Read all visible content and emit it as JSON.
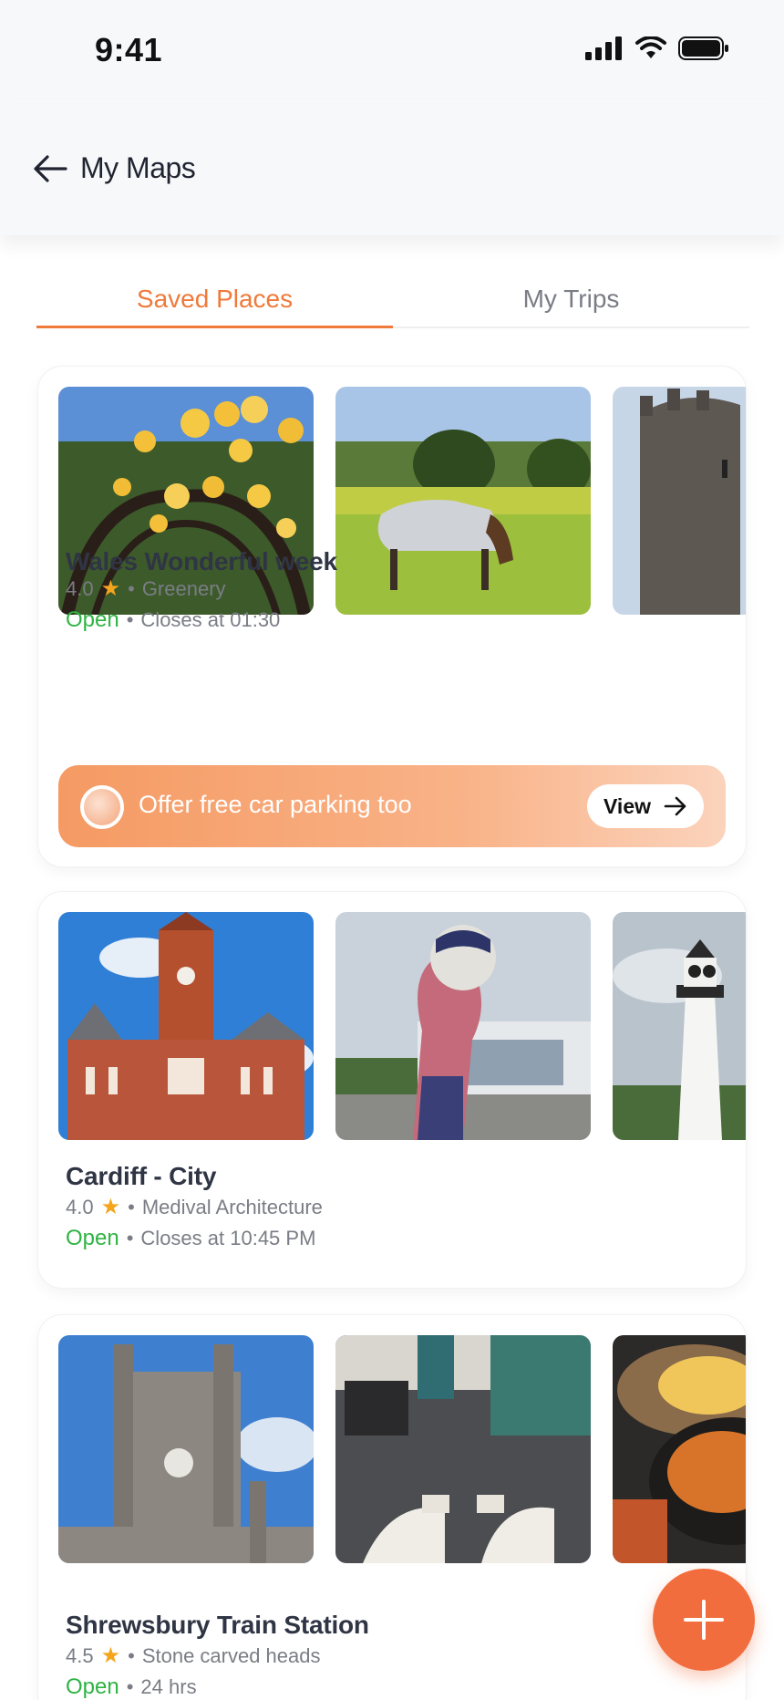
{
  "status_bar": {
    "time": "9:41"
  },
  "header": {
    "title": "My Maps"
  },
  "tabs": [
    {
      "label": "Saved Places",
      "active": true
    },
    {
      "label": "My Trips",
      "active": false
    }
  ],
  "cards": [
    {
      "title": "Wales Wonderful week",
      "rating": "4.0",
      "category": "Greenery",
      "status": "Open",
      "hours": "Closes at 01:30",
      "photos": [
        "yellow-roses-arbor",
        "horse-grazing-field",
        "stone-castle-tower"
      ],
      "offer": {
        "text": "Offer free car parking too",
        "button": "View"
      }
    },
    {
      "title": "Cardiff - City",
      "rating": "4.0",
      "category": "Medival Architecture",
      "status": "Open",
      "hours": "Closes at 10:45 PM",
      "photos": [
        "red-brick-clock-building",
        "hand-holding-ball-sculpture",
        "white-lighthouse"
      ]
    },
    {
      "title": "Shrewsbury Train Station",
      "rating": "4.5",
      "category": "Stone carved heads",
      "status": "Open",
      "hours": "24 hrs",
      "photos": [
        "gothic-clock-tower",
        "office-floor-feet",
        "fries-food-plate"
      ]
    }
  ],
  "colors": {
    "accent": "#ef7a3a",
    "open": "#2fb344",
    "star": "#f4a51b",
    "fab": "#f26d3d"
  },
  "icons": {
    "back": "arrow-left-icon",
    "fab": "plus-icon",
    "view": "arrow-right-icon",
    "rating": "star-icon"
  }
}
